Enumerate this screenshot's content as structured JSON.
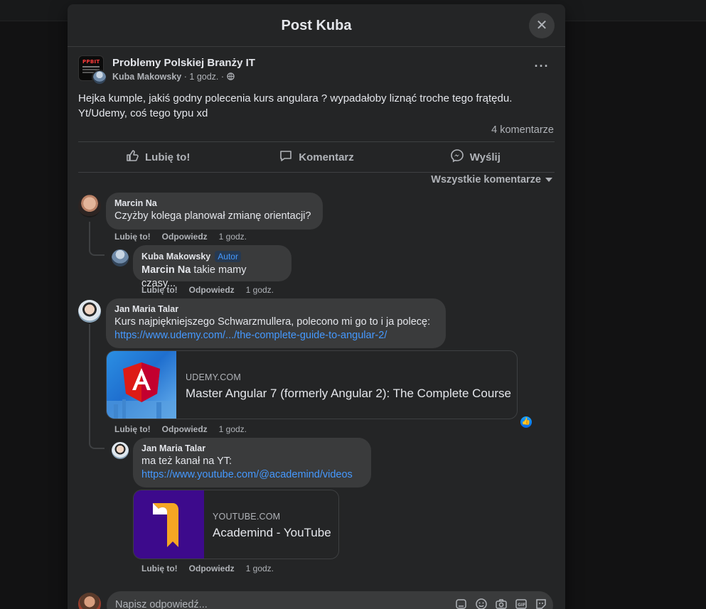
{
  "modal": {
    "title": "Post Kuba",
    "close_icon": "close-icon"
  },
  "post": {
    "group_name": "Problemy Polskiej Branży IT",
    "group_logo_text": "PPBIT",
    "author": "Kuba Makowsky",
    "time": "1 godz.",
    "separator": "·",
    "privacy_icon": "globe-icon",
    "text_line1": "Hejka kumple, jakiś godny polecenia kurs angulara ? wypadałoby liznąć troche tego frątędu.",
    "text_line2": "Yt/Udemy, coś tego typu xd",
    "comments_count": "4 komentarze"
  },
  "actions": {
    "like": "Lubię to!",
    "comment": "Komentarz",
    "share": "Wyślij"
  },
  "filter": {
    "label": "Wszystkie komentarze"
  },
  "comments": [
    {
      "author": "Marcin Na",
      "text": "Czyżby kolega planował zmianę orientacji?",
      "like": "Lubię to!",
      "reply": "Odpowiedz",
      "time": "1 godz."
    },
    {
      "author": "Kuba Makowsky",
      "badge": "Autor",
      "mention": "Marcin Na",
      "text": " takie mamy czasy...",
      "like": "Lubię to!",
      "reply": "Odpowiedz",
      "time": "1 godz."
    },
    {
      "author": "Jan Maria Talar",
      "text": "Kurs najpiękniejszego Schwarzmullera, polecono mi go to i ja polecę:",
      "link": "https://www.udemy.com/.../the-complete-guide-to-angular-2/",
      "card_domain": "UDEMY.COM",
      "card_title": "Master Angular 7 (formerly Angular 2): The Complete Course",
      "like": "Lubię to!",
      "reply": "Odpowiedz",
      "time": "1 godz.",
      "reaction": "like"
    },
    {
      "author": "Jan Maria Talar",
      "text": "ma też kanał na YT:",
      "link": "https://www.youtube.com/@academind/videos",
      "card_domain": "YOUTUBE.COM",
      "card_title": "Academind - YouTube",
      "like": "Lubię to!",
      "reply": "Odpowiedz",
      "time": "1 godz."
    }
  ],
  "reply_box": {
    "placeholder": "Napisz odpowiedź...",
    "icons": [
      "sticker-icon",
      "emoji-icon",
      "camera-icon",
      "gif-icon",
      "sticker-face-icon"
    ]
  },
  "colors": {
    "background": "#242526",
    "bubble": "#3a3b3c",
    "link": "#4599ff",
    "secondary_text": "#b0b3b8"
  }
}
